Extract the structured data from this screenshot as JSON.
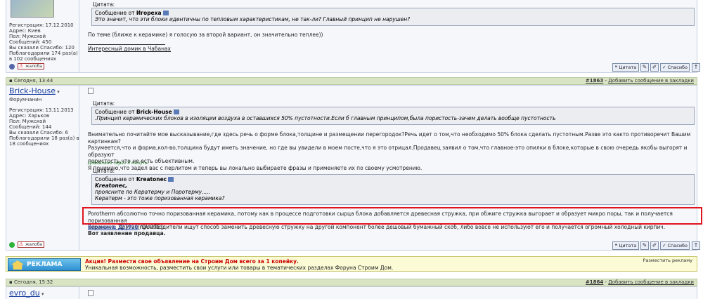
{
  "post1": {
    "sidebar_info": [
      "Регистрация: 17.12.2010",
      "Адрес: Киев",
      "Пол: Мужской",
      "Сообщений: 450",
      "Вы сказали Спасибо: 120",
      "Поблагодарили 174 раз(а) в 102 сообщениях"
    ],
    "report_label": "жалоба",
    "quote_label": "Цитата:",
    "quote_from_prefix": "Сообщение от",
    "quote_author": "Игореха",
    "quote_text": "Это значит, что эти блоки идентичны по тепловым характеристикам, не так-ли? Главный принцип не нарушен?",
    "body_text": "По теме (ближе к керамике) я голосую за второй вариант, он значительно теплее))",
    "signature_link": "Интересный домик в Чабанах",
    "buttons": {
      "quote": "Цитата",
      "thanks": "Спасибо"
    }
  },
  "post2": {
    "date": "Сегодня, 13:44",
    "number": "#1863",
    "bookmark_link": "Добавить сообщение в закладки",
    "username": "Brick-House",
    "user_title": "Форумчанин",
    "sidebar_info": [
      "Регистрация: 13.11.2013",
      "Адрес: Харьков",
      "Пол: Мужской",
      "Сообщений: 144",
      "Вы сказали Спасибо: 6",
      "Поблагодарили 18 раз(а) в 18 сообщениях"
    ],
    "report_label": "жалоба",
    "quote1_label": "Цитата:",
    "quote1_from_prefix": "Сообщение от",
    "quote1_author": "Brick-House",
    "quote1_text": ".Принцип керамических блоков в изоляции воздуха в оставшихся 50% пустотности.Если б главным принципом,была пористость-зачем делать вообще пустотность",
    "body_lines": [
      "Внимательно почитайте мое высказывание,где здесь речь о форме блока,толщине и размещении перегородок?Речь идет о том,что необходимо 50% блока сделать пустотным.Разве это както противоречит Вашим картинкам?",
      "Разумеется,что и форма,кол-во,толщина будут иметь значение, но где вы увидели в моем посте,что я это отрицал.Продавец заявил о том,что главное-это опилки в блоке,которые в свою очередь якобы выгорят и образуют",
      "пористость,что не есть объективным.",
      "Я понимаю,что задел вас с перлитом и теперь вы локально выбираете фразы и применяете их по своему усмотрению."
    ],
    "added_note": "Добавлено через 4 минуты",
    "quote2_label": "Цитата:",
    "quote2_from_prefix": "Сообщение от",
    "quote2_author": "Kreatonec",
    "quote2_lines": [
      "Kreatonec,",
      "проясните по Кератерму и Поротерму.....",
      "Кератерм - это тоже поризованная керамика?"
    ],
    "highlight_lines": [
      "Porotherm абсолютно точно поризованная керамика, потому как в процессе подготовки сырца блока добавляется древесная стружка, при обжиге стружка выгорает и образует микро поры, так и получается поризованная",
      "керамика. Другие производители ищут способ заменить древесную стружку на другой компонент более дешовый бумажный скоб, либо вовсе не используют его и получается огромный холодный кирпич."
    ],
    "attachment_link": "Вложение 327999",
    "attachment_tail": "[/QUOTE]",
    "closing_text": "Вот заявление продавца.",
    "buttons": {
      "quote": "Цитата",
      "thanks": "Спасибо"
    }
  },
  "ad": {
    "logo_label": "РЕКЛАМА",
    "headline": "Акция! Размести свое объявление на Строим Дом всего за 1 копейку.",
    "subtext": "Уникальная возможность, разместить свои услуги или товары в тематических разделах Форуна Строим Дом.",
    "place_link": "Разместить рекламу"
  },
  "post3": {
    "date": "Сегодня, 15:32",
    "number": "#1864",
    "bookmark_link": "Добавить сообщение в закладки",
    "username": "evro_du"
  }
}
